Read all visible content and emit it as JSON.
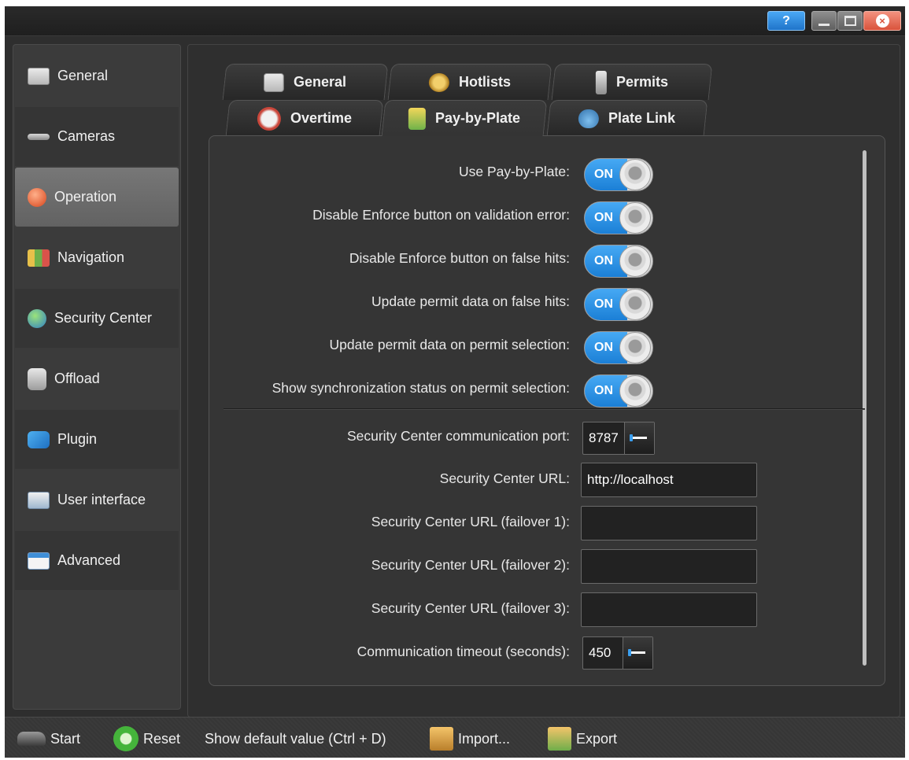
{
  "window": {
    "help_label": "?",
    "close_glyph": "×"
  },
  "sidebar": {
    "items": [
      {
        "label": "General",
        "icon": "general-icon"
      },
      {
        "label": "Cameras",
        "icon": "camera-icon"
      },
      {
        "label": "Operation",
        "icon": "operation-icon",
        "active": true
      },
      {
        "label": "Navigation",
        "icon": "map-icon"
      },
      {
        "label": "Security Center",
        "icon": "globe-icon"
      },
      {
        "label": "Offload",
        "icon": "database-icon"
      },
      {
        "label": "Plugin",
        "icon": "puzzle-icon"
      },
      {
        "label": "User interface",
        "icon": "user-interface-icon"
      },
      {
        "label": "Advanced",
        "icon": "window-icon"
      }
    ]
  },
  "tabs": {
    "row1": [
      {
        "label": "General",
        "icon": "general-icon"
      },
      {
        "label": "Hotlists",
        "icon": "sheriff-star-icon"
      },
      {
        "label": "Permits",
        "icon": "permit-meter-icon"
      }
    ],
    "row2": [
      {
        "label": "Overtime",
        "icon": "gauge-icon"
      },
      {
        "label": "Pay-by-Plate",
        "icon": "pay-by-plate-icon",
        "active": true
      },
      {
        "label": "Plate Link",
        "icon": "cloud-link-icon"
      }
    ]
  },
  "settings": {
    "toggles": [
      {
        "label": "Use Pay-by-Plate:",
        "state": "ON"
      },
      {
        "label": "Disable Enforce button on validation error:",
        "state": "ON"
      },
      {
        "label": "Disable Enforce button on false hits:",
        "state": "ON"
      },
      {
        "label": "Update permit data on false hits:",
        "state": "ON"
      },
      {
        "label": "Update permit data on permit selection:",
        "state": "ON"
      },
      {
        "label": "Show synchronization status on permit selection:",
        "state": "ON"
      }
    ],
    "port": {
      "label": "Security Center communication port:",
      "value": "8787"
    },
    "url": {
      "label": "Security Center URL:",
      "value": "http://localhost"
    },
    "failover1": {
      "label": "Security Center URL (failover 1):",
      "value": ""
    },
    "failover2": {
      "label": "Security Center URL (failover 2):",
      "value": ""
    },
    "failover3": {
      "label": "Security Center URL (failover 3):",
      "value": ""
    },
    "timeout": {
      "label": "Communication timeout (seconds):",
      "value": "450"
    }
  },
  "toolbar": {
    "start": "Start",
    "reset": "Reset",
    "show_default": "Show default value (Ctrl + D)",
    "import": "Import...",
    "export": "Export"
  },
  "colors": {
    "accent": "#1b7fd6",
    "background": "#2e2e2e",
    "close": "#d9533c"
  }
}
